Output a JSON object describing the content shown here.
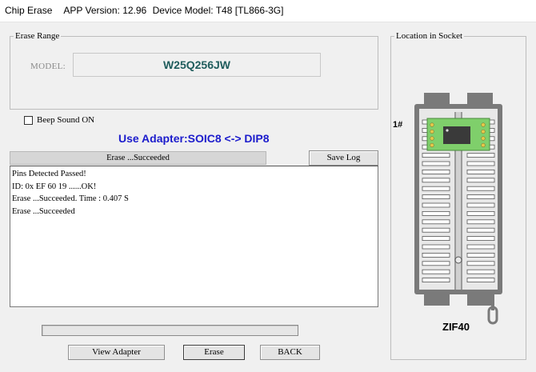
{
  "window": {
    "title": "Chip Erase",
    "app_version": "APP Version: 12.96",
    "device_model": "Device Model: T48 [TL866-3G]"
  },
  "erase_range": {
    "legend": "Erase Range",
    "model_label": "MODEL:",
    "model_value": "W25Q256JW"
  },
  "beep": {
    "label": "Beep Sound ON",
    "checked": false
  },
  "adapter_text": "Use Adapter:SOIC8 <-> DIP8",
  "status_text": "Erase  ...Succeeded",
  "save_log_label": "Save Log",
  "log_lines": [
    "Pins Detected Passed!",
    "ID: 0x EF 60 19 ......OK!",
    "Erase  ...Succeeded. Time : 0.407 S",
    "Erase  ...Succeeded"
  ],
  "progress": {
    "value": 0
  },
  "buttons": {
    "view_adapter": "View Adapter",
    "erase": "Erase",
    "back": "BACK"
  },
  "location": {
    "legend": "Location in Socket",
    "pin1_label": "1#",
    "socket_label": "ZIF40"
  },
  "colors": {
    "model_text": "#1f5c5c",
    "adapter_text": "#1c1ccc",
    "pcb_green": "#7fcf6b",
    "socket_gray": "#7a7a7a"
  }
}
